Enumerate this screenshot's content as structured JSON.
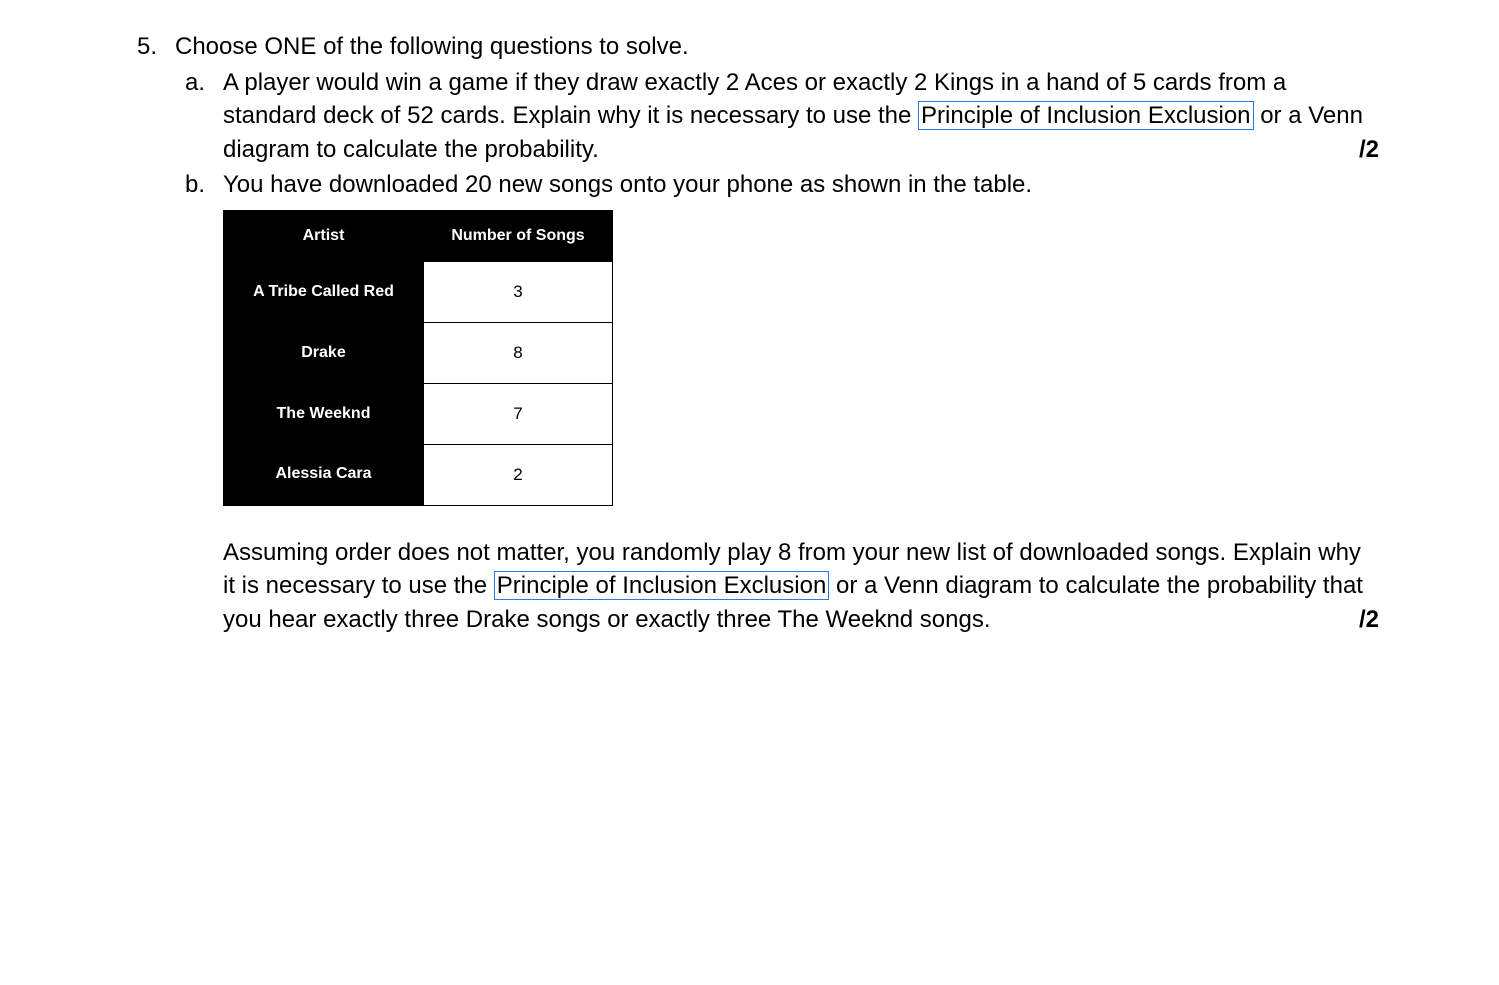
{
  "question": {
    "number": "5.",
    "prompt": "Choose ONE of the following questions to solve.",
    "subs": {
      "a": {
        "letter": "a.",
        "text_before_box": "A player would win a game if they draw exactly 2 Aces or exactly 2 Kings in a hand of 5 cards from a standard deck of 52 cards.  Explain why it is necessary to use the ",
        "boxed": "Principle of Inclusion Exclusion",
        "text_after_box": " or a Venn diagram to calculate the probability.",
        "score": "/2"
      },
      "b": {
        "letter": "b.",
        "intro": "You have downloaded 20 new songs onto your phone as shown in the table.",
        "table": {
          "headers": [
            "Artist",
            "Number of Songs"
          ],
          "rows": [
            {
              "artist": "A Tribe Called Red",
              "count": "3"
            },
            {
              "artist": "Drake",
              "count": "8"
            },
            {
              "artist": "The Weeknd",
              "count": "7"
            },
            {
              "artist": "Alessia Cara",
              "count": "2"
            }
          ]
        },
        "text_before_box": "Assuming order does not matter, you randomly play 8 from your new list of downloaded songs.  Explain why it is necessary to use the ",
        "boxed": "Principle of Inclusion Exclusion",
        "text_after_box": " or a Venn diagram to calculate the probability that you hear exactly three Drake songs or exactly three The Weeknd songs.",
        "score": "/2"
      }
    }
  }
}
